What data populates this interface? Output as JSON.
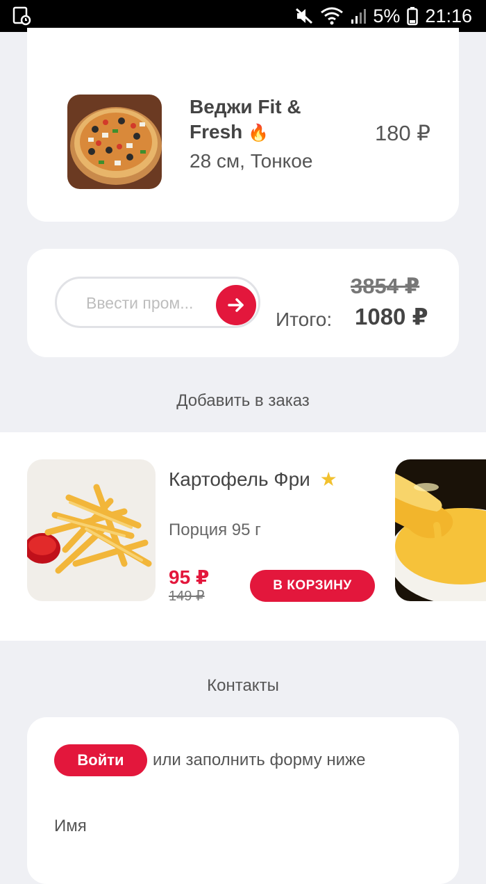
{
  "status_bar": {
    "battery": "5%",
    "time": "21:16",
    "icons": [
      "screenshot-notification-icon",
      "mute-icon",
      "wifi-icon",
      "signal-icon",
      "battery-icon"
    ]
  },
  "product": {
    "name_line1": "Веджи Fit &",
    "name_line2": "Fresh",
    "name_emoji": "🔥",
    "description": "28 см, Тонкое",
    "price": "180 ₽"
  },
  "promo": {
    "placeholder": "Ввести пром...",
    "total_label": "Итого:",
    "old_total": "3854 ₽",
    "new_total": "1080 ₽"
  },
  "addons": {
    "section_title": "Добавить в заказ",
    "items": [
      {
        "name": "Картофель Фри",
        "badge": "★",
        "description": "Порция 95 г",
        "price": "95 ₽",
        "old_price": "149 ₽",
        "button": "В КОРЗИНУ"
      }
    ]
  },
  "contacts": {
    "section_title": "Контакты",
    "login_button": "Войти",
    "login_hint": "или заполнить форму ниже",
    "name_label": "Имя"
  },
  "colors": {
    "accent": "#e3173c",
    "background": "#eff0f4",
    "card": "#ffffff"
  }
}
